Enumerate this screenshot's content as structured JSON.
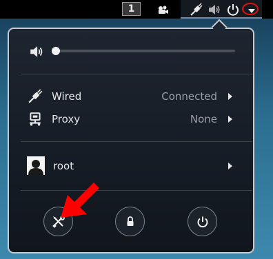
{
  "topbar": {
    "workspace_number": "1",
    "icons": [
      "webcam-icon",
      "network-wired-icon",
      "volume-icon",
      "power-icon",
      "dropdown-arrow-icon"
    ]
  },
  "menu": {
    "volume": {
      "icon": "volume-icon",
      "level_percent": 0
    },
    "network": {
      "icon": "network-wired-icon",
      "label": "Wired",
      "status": "Connected"
    },
    "proxy": {
      "icon": "proxy-icon",
      "label": "Proxy",
      "status": "None"
    },
    "user": {
      "icon": "avatar",
      "label": "root"
    },
    "buttons": {
      "settings": "settings-tools-icon",
      "lock": "lock-icon",
      "power": "power-icon"
    }
  },
  "annotations": {
    "red_arrow_color": "#ff0000",
    "red_ring_color": "#e01010"
  }
}
